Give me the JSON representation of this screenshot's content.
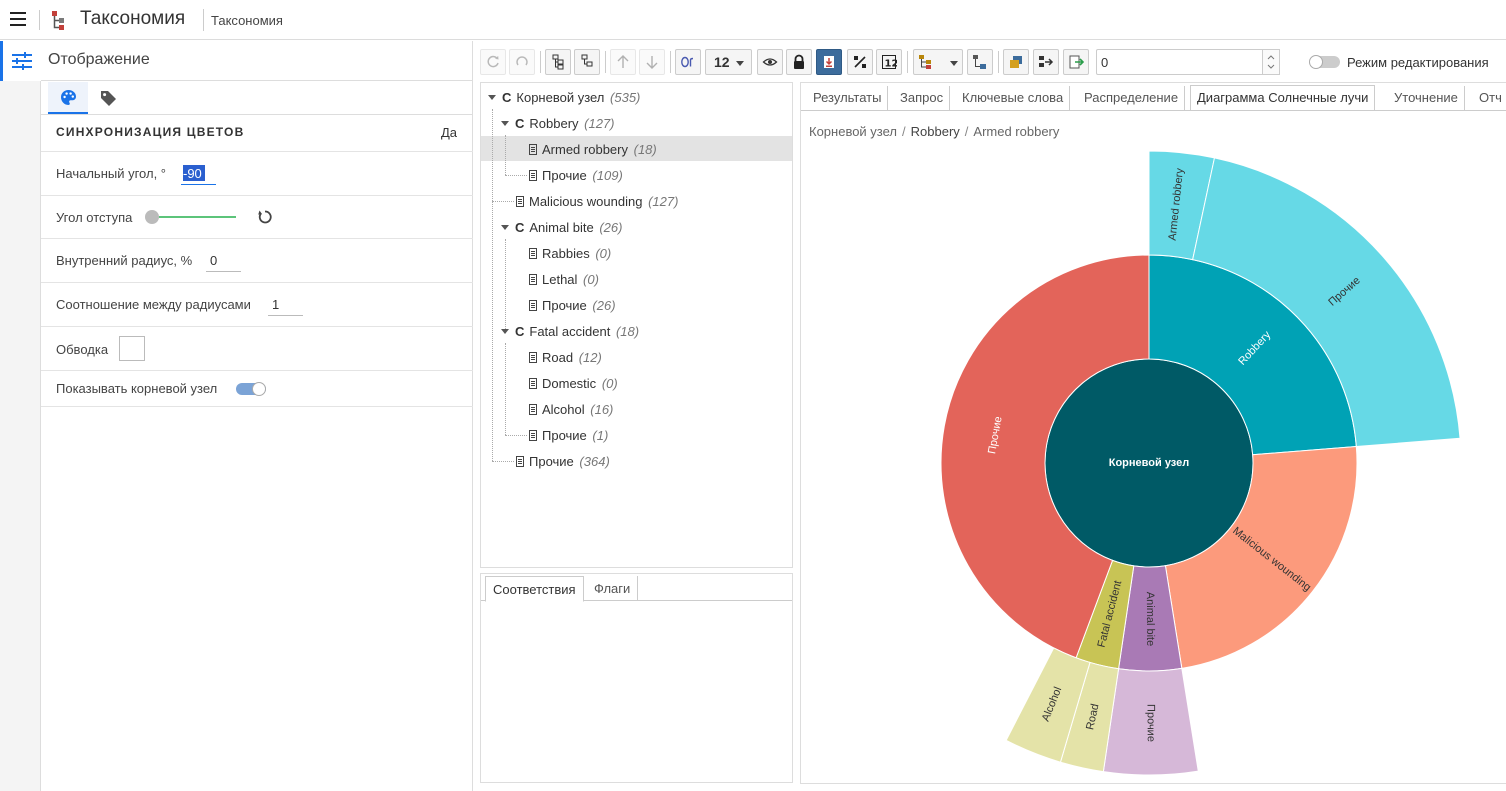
{
  "app": {
    "title": "Таксономия",
    "subtitle": "Таксономия"
  },
  "settings": {
    "title": "Отображение",
    "sync_colors_label": "Синхронизация цветов",
    "sync_colors_value": "Да",
    "start_angle_label": "Начальный угол, °",
    "start_angle_value": "-90",
    "gap_angle_label": "Угол отступа",
    "inner_radius_label": "Внутренний радиус, %",
    "inner_radius_value": "0",
    "radius_ratio_label": "Соотношение между радиусами",
    "radius_ratio_value": "1",
    "stroke_label": "Обводка",
    "show_root_label": "Показывать корневой узел",
    "show_root_on": true
  },
  "toolbar": {
    "font_size": "12",
    "search_value": "0",
    "edit_mode_label": "Режим редактирования",
    "edit_mode_on": false
  },
  "tree": {
    "nodes": [
      {
        "label": "Корневой узел",
        "count": "(535)",
        "type": "category"
      },
      {
        "label": "Robbery",
        "count": "(127)",
        "type": "category"
      },
      {
        "label": "Armed robbery",
        "count": "(18)",
        "type": "document",
        "selected": true
      },
      {
        "label": "Прочие",
        "count": "(109)",
        "type": "document"
      },
      {
        "label": "Malicious wounding",
        "count": "(127)",
        "type": "document"
      },
      {
        "label": "Animal bite",
        "count": "(26)",
        "type": "category"
      },
      {
        "label": "Rabbies",
        "count": "(0)",
        "type": "document"
      },
      {
        "label": "Lethal",
        "count": "(0)",
        "type": "document"
      },
      {
        "label": "Прочие",
        "count": "(26)",
        "type": "document"
      },
      {
        "label": "Fatal accident",
        "count": "(18)",
        "type": "category"
      },
      {
        "label": "Road",
        "count": "(12)",
        "type": "document"
      },
      {
        "label": "Domestic",
        "count": "(0)",
        "type": "document"
      },
      {
        "label": "Alcohol",
        "count": "(16)",
        "type": "document"
      },
      {
        "label": "Прочие",
        "count": "(1)",
        "type": "document"
      },
      {
        "label": "Прочие",
        "count": "(364)",
        "type": "document"
      }
    ]
  },
  "bottom_tabs": [
    "Соответствия",
    "Флаги"
  ],
  "right_tabs": [
    "Результаты",
    "Запрос",
    "Ключевые слова",
    "Распределение",
    "Диаграмма Солнечные лучи",
    "Уточнение",
    "Отч"
  ],
  "right_active_tab": 4,
  "breadcrumb": [
    "Корневой узел",
    "Robbery",
    "Armed robbery"
  ],
  "sunburst": {
    "root_label": "Корневой узел",
    "root_color": "#005a66",
    "ring1": [
      {
        "label": "Robbery",
        "value": 127,
        "color": "#00a2b5"
      },
      {
        "label": "Malicious wounding",
        "value": 127,
        "color": "#fc9a7c"
      },
      {
        "label": "Animal bite",
        "value": 26,
        "color": "#a97ab5"
      },
      {
        "label": "Fatal accident",
        "value": 18,
        "color": "#c8c455"
      },
      {
        "label": "Прочие",
        "value": 237,
        "color": "#e3645a"
      }
    ],
    "ring2": [
      {
        "label": "Armed robbery",
        "value": 18,
        "parent": 0,
        "color": "#66d9e6"
      },
      {
        "label": "Прочие",
        "value": 109,
        "parent": 0,
        "color": "#66d9e6"
      },
      {
        "label": "Прочие",
        "value": 26,
        "parent": 2,
        "color": "#d6b8d8"
      },
      {
        "label": "Road",
        "value": 12,
        "parent": 3,
        "color": "#e4e3a8"
      },
      {
        "label": "Alcohol",
        "value": 16,
        "parent": 3,
        "color": "#e4e3a8"
      }
    ]
  }
}
